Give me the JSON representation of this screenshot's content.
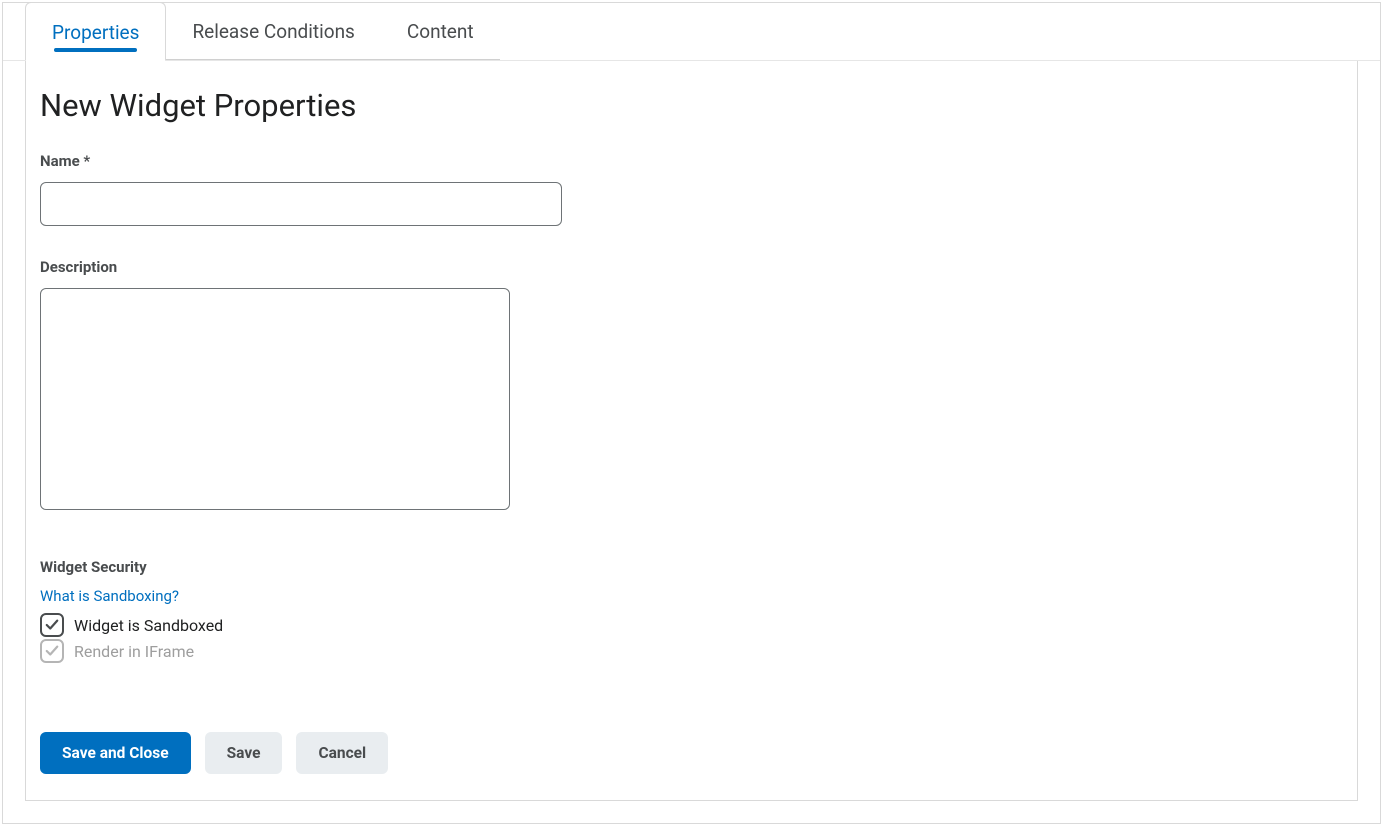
{
  "tabs": {
    "properties": "Properties",
    "release_conditions": "Release Conditions",
    "content": "Content"
  },
  "page_title": "New Widget Properties",
  "fields": {
    "name_label": "Name *",
    "name_value": "",
    "description_label": "Description",
    "description_value": ""
  },
  "security": {
    "section_label": "Widget Security",
    "help_link": "What is Sandboxing?",
    "sandboxed_label": "Widget is Sandboxed",
    "sandboxed_checked": true,
    "iframe_label": "Render in IFrame",
    "iframe_checked": true,
    "iframe_disabled": true
  },
  "buttons": {
    "save_close": "Save and Close",
    "save": "Save",
    "cancel": "Cancel"
  }
}
